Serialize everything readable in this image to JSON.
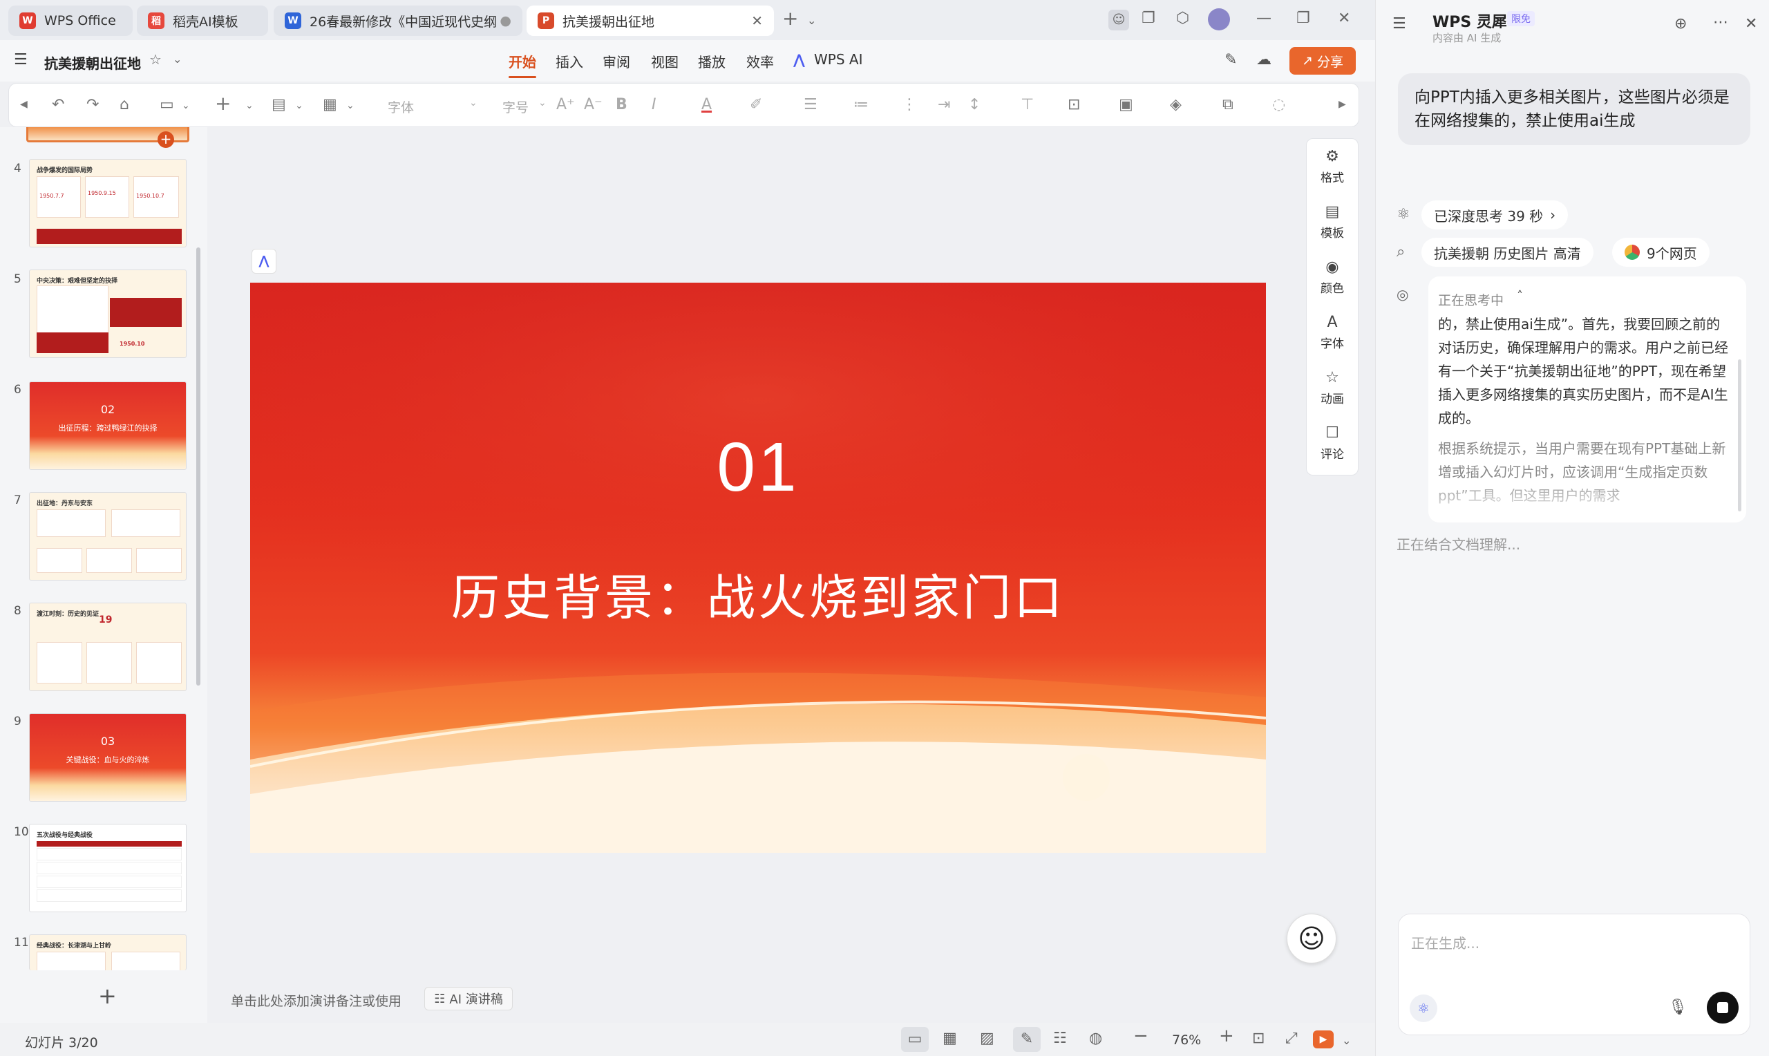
{
  "tabs": [
    {
      "label": "WPS Office",
      "icon": "wps-logo-icon"
    },
    {
      "label": "稻壳AI模板",
      "icon": "docer-icon"
    },
    {
      "label": "26春最新修改《中国近现代史纲",
      "icon": "word-icon"
    },
    {
      "label": "抗美援朝出征地",
      "icon": "ppt-icon"
    }
  ],
  "doc": {
    "title": "抗美援朝出征地",
    "share": "分享"
  },
  "menu": [
    "开始",
    "插入",
    "审阅",
    "视图",
    "播放",
    "效率",
    "WPS AI"
  ],
  "toolbar": {
    "font_placeholder": "字体",
    "size_placeholder": "字号"
  },
  "slides": [
    {
      "num": "4",
      "title": "战争爆发的国际局势",
      "dates": [
        "1950.7.7",
        "1950.9.15",
        "1950.10.7"
      ]
    },
    {
      "num": "5",
      "title": "中央决策：艰难但坚定的抉择",
      "date": "1950.10"
    },
    {
      "num": "6",
      "big": "02",
      "sub": "出征历程：跨过鸭绿江的抉择"
    },
    {
      "num": "7",
      "title": "出征地：丹东与安东"
    },
    {
      "num": "8",
      "title": "渡江时刻：历史的见证",
      "stat": "19"
    },
    {
      "num": "9",
      "big": "03",
      "sub": "关键战役：血与火的淬炼"
    },
    {
      "num": "10",
      "title": "五次战役与经典战役"
    },
    {
      "num": "11",
      "title": "经典战役：长津湖与上甘岭"
    }
  ],
  "main_slide": {
    "number": "01",
    "title": "历史背景：战火烧到家门口"
  },
  "notes": {
    "placeholder": "单击此处添加演讲备注或使用",
    "ai_button": "AI 演讲稿"
  },
  "side_tools": [
    "格式",
    "模板",
    "颜色",
    "字体",
    "动画",
    "评论"
  ],
  "status": {
    "slide_count": "幻灯片 3/20",
    "zoom": "76%"
  },
  "assistant": {
    "title": "WPS 灵犀",
    "badge": "限免",
    "subtitle": "内容由 AI 生成",
    "user_message": "向PPT内插入更多相关图片，这些图片必须是在网络搜集的，禁止使用ai生成",
    "deep_think": "已深度思考 39 秒",
    "search_query": "抗美援朝 历史图片 高清",
    "web_count": "9个网页",
    "thinking_label": "正在思考中",
    "thinking_p1": "的，禁止使用ai生成”。首先，我要回顾之前的对话历史，确保理解用户的需求。用户之前已经有一个关于“抗美援朝出征地”的PPT，现在希望插入更多网络搜集的真实历史图片，而不是AI生成的。",
    "thinking_p2": "根据系统提示，当用户需要在现有PPT基础上新增或插入幻灯片时，应该调用“生成指定页数ppt”工具。但这里用户的需求",
    "status_line": "正在结合文档理解...",
    "input_placeholder": "正在生成..."
  },
  "colors": {
    "accent": "#d9501e",
    "share": "#e9662c",
    "slide_red": "#e02e2a"
  }
}
